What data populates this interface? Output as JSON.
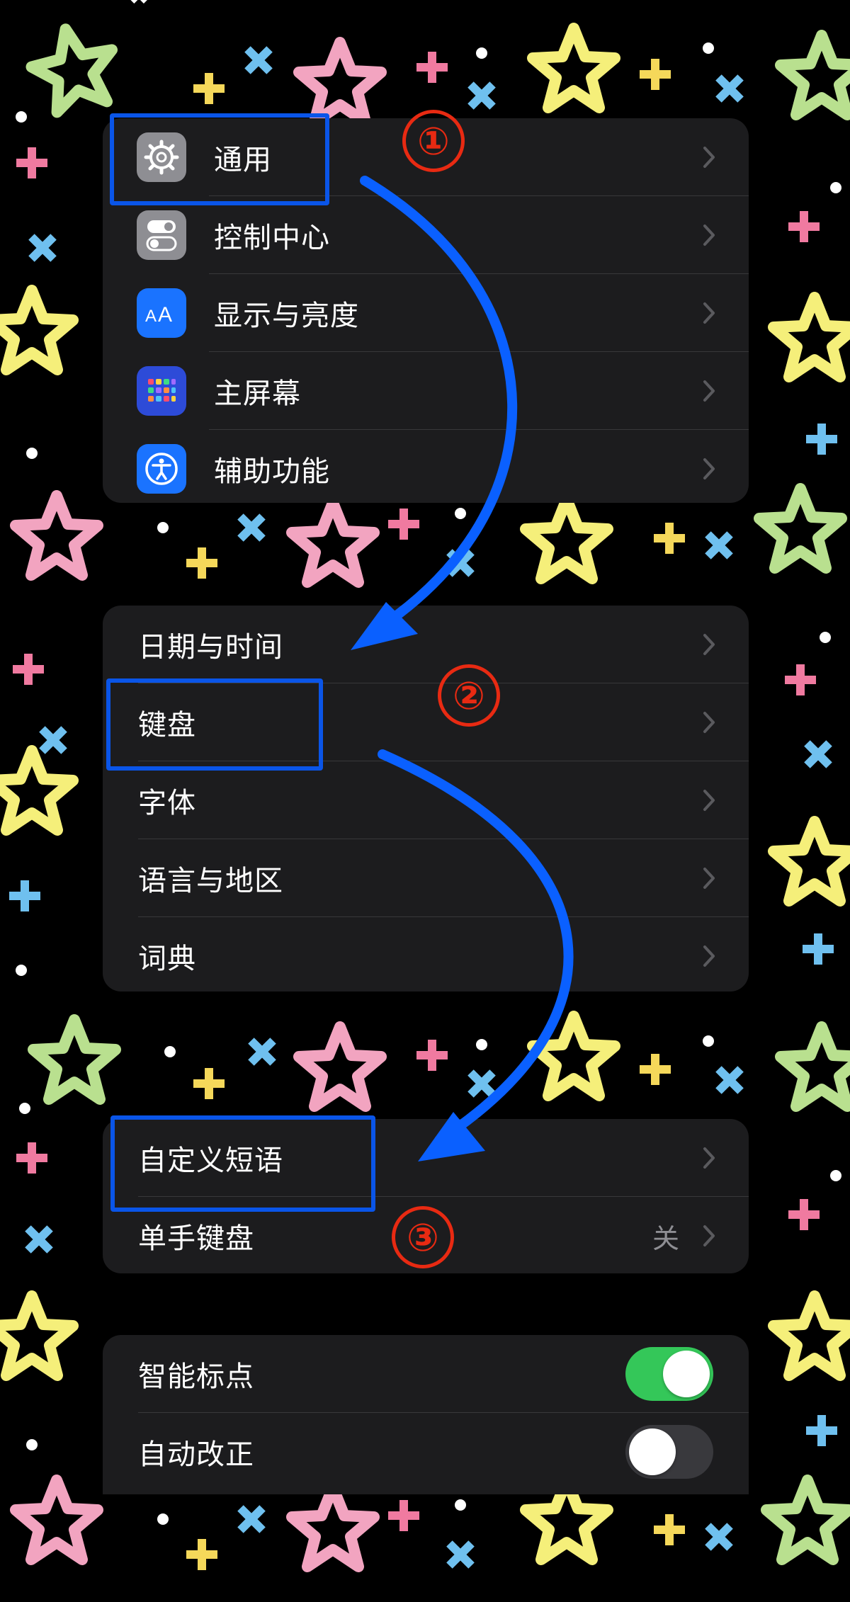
{
  "colors": {
    "accent_blue": "#0a60ff",
    "annotation_red": "#e82a12",
    "toggle_on": "#34c759",
    "group_bg": "#1c1c1e"
  },
  "group1": {
    "items": [
      {
        "label": "通用",
        "icon": "gear-icon",
        "icon_bg": "#8e8e93"
      },
      {
        "label": "控制中心",
        "icon": "switches-icon",
        "icon_bg": "#8e8e93"
      },
      {
        "label": "显示与亮度",
        "icon": "text-size-icon",
        "icon_bg": "#1a73ff"
      },
      {
        "label": "主屏幕",
        "icon": "home-grid-icon",
        "icon_bg": "#2d4bd8"
      },
      {
        "label": "辅助功能",
        "icon": "accessibility-icon",
        "icon_bg": "#1a73ff"
      }
    ]
  },
  "group2": {
    "items": [
      {
        "label": "日期与时间"
      },
      {
        "label": "键盘"
      },
      {
        "label": "字体"
      },
      {
        "label": "语言与地区"
      },
      {
        "label": "词典"
      }
    ]
  },
  "group3": {
    "items": [
      {
        "label": "自定义短语"
      },
      {
        "label": "单手键盘",
        "value": "关"
      }
    ]
  },
  "group4": {
    "items": [
      {
        "label": "智能标点",
        "toggle": true
      },
      {
        "label": "自动改正",
        "toggle": false
      }
    ]
  },
  "annotations": {
    "step1": "①",
    "step2": "②",
    "step3": "③"
  }
}
